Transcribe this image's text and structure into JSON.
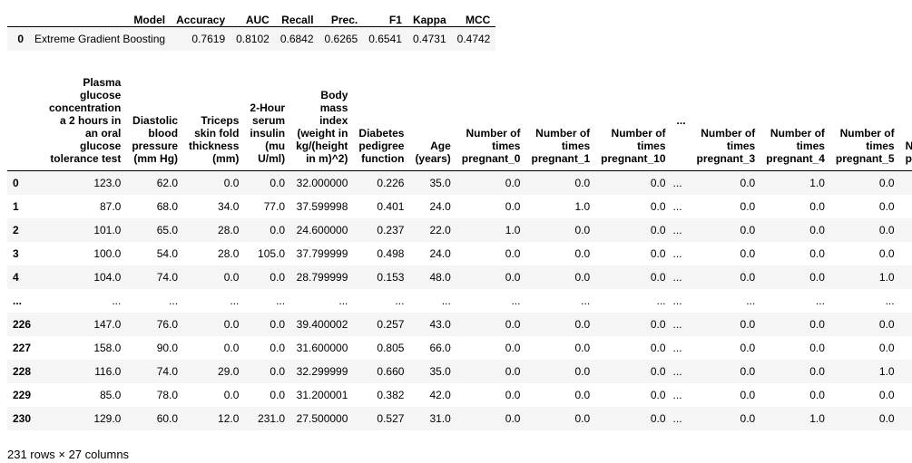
{
  "metrics_table": {
    "columns": [
      "",
      "Model",
      "Accuracy",
      "AUC",
      "Recall",
      "Prec.",
      "F1",
      "Kappa",
      "MCC"
    ],
    "rows": [
      {
        "index": "0",
        "model": "Extreme Gradient Boosting",
        "accuracy": "0.7619",
        "auc": "0.8102",
        "recall": "0.6842",
        "prec": "0.6265",
        "f1": "0.6541",
        "kappa": "0.4731",
        "mcc": "0.4742"
      }
    ]
  },
  "data_table": {
    "columns": [
      "",
      "Plasma glucose concentration a 2 hours in an oral glucose tolerance test",
      "Diastolic blood pressure (mm Hg)",
      "Triceps skin fold thickness (mm)",
      "2-Hour serum insulin (mu U/ml)",
      "Body mass index (weight in kg/(height in m)^2)",
      "Diabetes pedigree function",
      "Age (years)",
      "Number of times pregnant_0",
      "Number of times pregnant_1",
      "Number of times pregnant_10",
      "...",
      "Number of times pregnant_3",
      "Number of times pregnant_4",
      "Number of times pregnant_5",
      "N p"
    ],
    "rows": [
      {
        "index": "0",
        "cells": [
          "123.0",
          "62.0",
          "0.0",
          "0.0",
          "32.000000",
          "0.226",
          "35.0",
          "0.0",
          "0.0",
          "0.0",
          "...",
          "0.0",
          "1.0",
          "0.0",
          ""
        ]
      },
      {
        "index": "1",
        "cells": [
          "87.0",
          "68.0",
          "34.0",
          "77.0",
          "37.599998",
          "0.401",
          "24.0",
          "0.0",
          "1.0",
          "0.0",
          "...",
          "0.0",
          "0.0",
          "0.0",
          ""
        ]
      },
      {
        "index": "2",
        "cells": [
          "101.0",
          "65.0",
          "28.0",
          "0.0",
          "24.600000",
          "0.237",
          "22.0",
          "1.0",
          "0.0",
          "0.0",
          "...",
          "0.0",
          "0.0",
          "0.0",
          ""
        ]
      },
      {
        "index": "3",
        "cells": [
          "100.0",
          "54.0",
          "28.0",
          "105.0",
          "37.799999",
          "0.498",
          "24.0",
          "0.0",
          "0.0",
          "0.0",
          "...",
          "0.0",
          "0.0",
          "0.0",
          ""
        ]
      },
      {
        "index": "4",
        "cells": [
          "104.0",
          "74.0",
          "0.0",
          "0.0",
          "28.799999",
          "0.153",
          "48.0",
          "0.0",
          "0.0",
          "0.0",
          "...",
          "0.0",
          "0.0",
          "1.0",
          ""
        ]
      },
      {
        "index": "...",
        "cells": [
          "...",
          "...",
          "...",
          "...",
          "...",
          "...",
          "...",
          "...",
          "...",
          "...",
          "...",
          "...",
          "...",
          "...",
          ""
        ]
      },
      {
        "index": "226",
        "cells": [
          "147.0",
          "76.0",
          "0.0",
          "0.0",
          "39.400002",
          "0.257",
          "43.0",
          "0.0",
          "0.0",
          "0.0",
          "...",
          "0.0",
          "0.0",
          "0.0",
          ""
        ]
      },
      {
        "index": "227",
        "cells": [
          "158.0",
          "90.0",
          "0.0",
          "0.0",
          "31.600000",
          "0.805",
          "66.0",
          "0.0",
          "0.0",
          "0.0",
          "...",
          "0.0",
          "0.0",
          "0.0",
          ""
        ]
      },
      {
        "index": "228",
        "cells": [
          "116.0",
          "74.0",
          "29.0",
          "0.0",
          "32.299999",
          "0.660",
          "35.0",
          "0.0",
          "0.0",
          "0.0",
          "...",
          "0.0",
          "0.0",
          "1.0",
          ""
        ]
      },
      {
        "index": "229",
        "cells": [
          "85.0",
          "78.0",
          "0.0",
          "0.0",
          "31.200001",
          "0.382",
          "42.0",
          "0.0",
          "0.0",
          "0.0",
          "...",
          "0.0",
          "0.0",
          "0.0",
          ""
        ]
      },
      {
        "index": "230",
        "cells": [
          "129.0",
          "60.0",
          "12.0",
          "231.0",
          "27.500000",
          "0.527",
          "31.0",
          "0.0",
          "0.0",
          "0.0",
          "...",
          "0.0",
          "1.0",
          "0.0",
          ""
        ]
      }
    ]
  },
  "summary": "231 rows × 27 columns",
  "colors": {
    "row_stripe": "#f5f5f5",
    "header_border": "#000000",
    "text": "#000000"
  }
}
